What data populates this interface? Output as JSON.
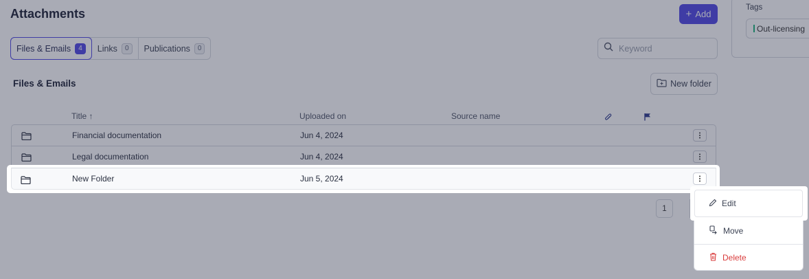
{
  "header": {
    "title": "Attachments",
    "add_label": "Add"
  },
  "tabs": [
    {
      "label": "Files & Emails",
      "count": "4"
    },
    {
      "label": "Links",
      "count": "0"
    },
    {
      "label": "Publications",
      "count": "0"
    }
  ],
  "search": {
    "placeholder": "Keyword"
  },
  "tags": {
    "label": "Tags",
    "chip": "Out-licensing"
  },
  "section": {
    "title": "Files & Emails",
    "new_folder_label": "New folder"
  },
  "table": {
    "columns": [
      "Title ↑",
      "Uploaded on",
      "Source name"
    ],
    "rows": [
      {
        "title": "Financial documentation",
        "uploaded": "Jun 4, 2024"
      },
      {
        "title": "Legal documentation",
        "uploaded": "Jun 4, 2024"
      },
      {
        "title": "New Folder",
        "uploaded": "Jun 5, 2024"
      }
    ]
  },
  "pagination": {
    "page": "1"
  },
  "context_menu": {
    "edit": "Edit",
    "move": "Move",
    "delete": "Delete"
  },
  "colors": {
    "accent": "#4f46e5",
    "danger": "#d93b3b",
    "tag_green": "#18b57a"
  },
  "icons": [
    "plus-icon",
    "search-icon",
    "folder-plus-icon",
    "folder-icon",
    "paperclip-icon",
    "flag-icon",
    "kebab-icon",
    "pencil-icon",
    "move-icon",
    "trash-icon"
  ]
}
